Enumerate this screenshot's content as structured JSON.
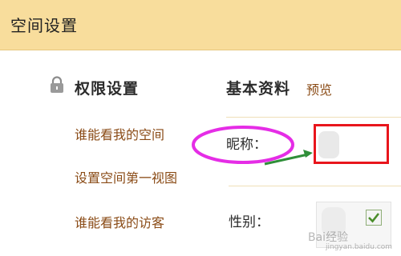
{
  "header": {
    "title": "空间设置"
  },
  "sidebar": {
    "title": "权限设置",
    "items": [
      {
        "label": "谁能看我的空间"
      },
      {
        "label": "设置空间第一视图"
      },
      {
        "label": "谁能看我的访客"
      }
    ]
  },
  "main": {
    "title": "基本资料",
    "preview_label": "预览",
    "fields": {
      "nickname_label": "昵称：",
      "nickname_value": "",
      "gender_label": "性别："
    }
  },
  "annotations": {
    "ellipse_color": "#e52de6",
    "box_color": "#e8151c",
    "arrow_color": "#2f8f39"
  },
  "icons": {
    "lock": "lock-icon",
    "check": "check-icon"
  },
  "watermark": {
    "text": "Bai经验",
    "sub": "jingyan.baidu.com"
  }
}
